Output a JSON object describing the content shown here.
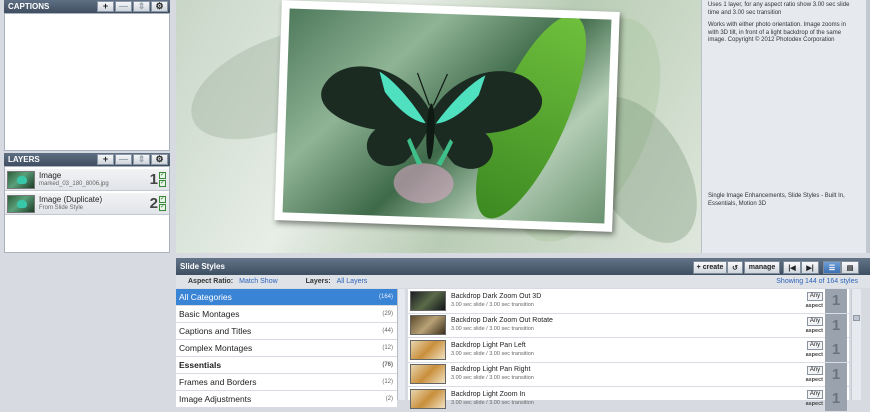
{
  "captions_panel": {
    "title": "CAPTIONS"
  },
  "layers_panel": {
    "title": "LAYERS",
    "layers": [
      {
        "name": "Image",
        "sub": "marked_03_180_8006.jpg",
        "number": "1"
      },
      {
        "name": "Image (Duplicate)",
        "sub": "From Slide Style",
        "number": "2"
      }
    ]
  },
  "panel_controls": {
    "add": "+",
    "remove": "—",
    "settings": "⚙",
    "drag": "⇕"
  },
  "info": {
    "description": "Uses 1 layer, for any aspect ratio show 3.00 sec slide time and 3.00 sec transition",
    "works_with": "Works with either photo orientation. Image zooms in with 3D tilt, in front of a light backdrop of the same image. Copyright © 2012 Photodex Corporation",
    "tags": "Single Image Enhancements, Slide Styles - Built In, Essentials, Motion 3D"
  },
  "slide_styles": {
    "title": "Slide Styles",
    "create_label": "create",
    "manage_label": "manage",
    "refresh_icon": "↺",
    "prev_icon": "|◀",
    "next_icon": "▶|",
    "aspect_label": "Aspect Ratio:",
    "aspect_value": "Match Show",
    "layers_label": "Layers:",
    "layers_value": "All Layers",
    "showing": "Showing 144 of 164 styles",
    "categories": [
      {
        "label": "All Categories",
        "count": "(164)"
      },
      {
        "label": "Basic Montages",
        "count": "(29)"
      },
      {
        "label": "Captions and Titles",
        "count": "(44)"
      },
      {
        "label": "Complex Montages",
        "count": "(12)"
      },
      {
        "label": "Essentials",
        "count": "(76)"
      },
      {
        "label": "Frames and Borders",
        "count": "(12)"
      },
      {
        "label": "Image Adjustments",
        "count": "(2)"
      }
    ],
    "styles": [
      {
        "name": "Backdrop Dark Zoom Out 3D",
        "detail": "3.00 sec slide / 3.00 sec transition",
        "any": "Any",
        "aspect": "aspect",
        "layers": "1"
      },
      {
        "name": "Backdrop Dark Zoom Out Rotate",
        "detail": "3.00 sec slide / 3.00 sec transition",
        "any": "Any",
        "aspect": "aspect",
        "layers": "1"
      },
      {
        "name": "Backdrop Light Pan Left",
        "detail": "3.00 sec slide / 3.00 sec transition",
        "any": "Any",
        "aspect": "aspect",
        "layers": "1"
      },
      {
        "name": "Backdrop Light Pan Right",
        "detail": "3.00 sec slide / 3.00 sec transition",
        "any": "Any",
        "aspect": "aspect",
        "layers": "1"
      },
      {
        "name": "Backdrop Light Zoom In",
        "detail": "3.00 sec slide / 3.00 sec transition",
        "any": "Any",
        "aspect": "aspect",
        "layers": "1"
      }
    ]
  },
  "colors": {
    "accent": "#3a84d6",
    "header": "#4a5a6d",
    "link": "#2e63b8"
  }
}
